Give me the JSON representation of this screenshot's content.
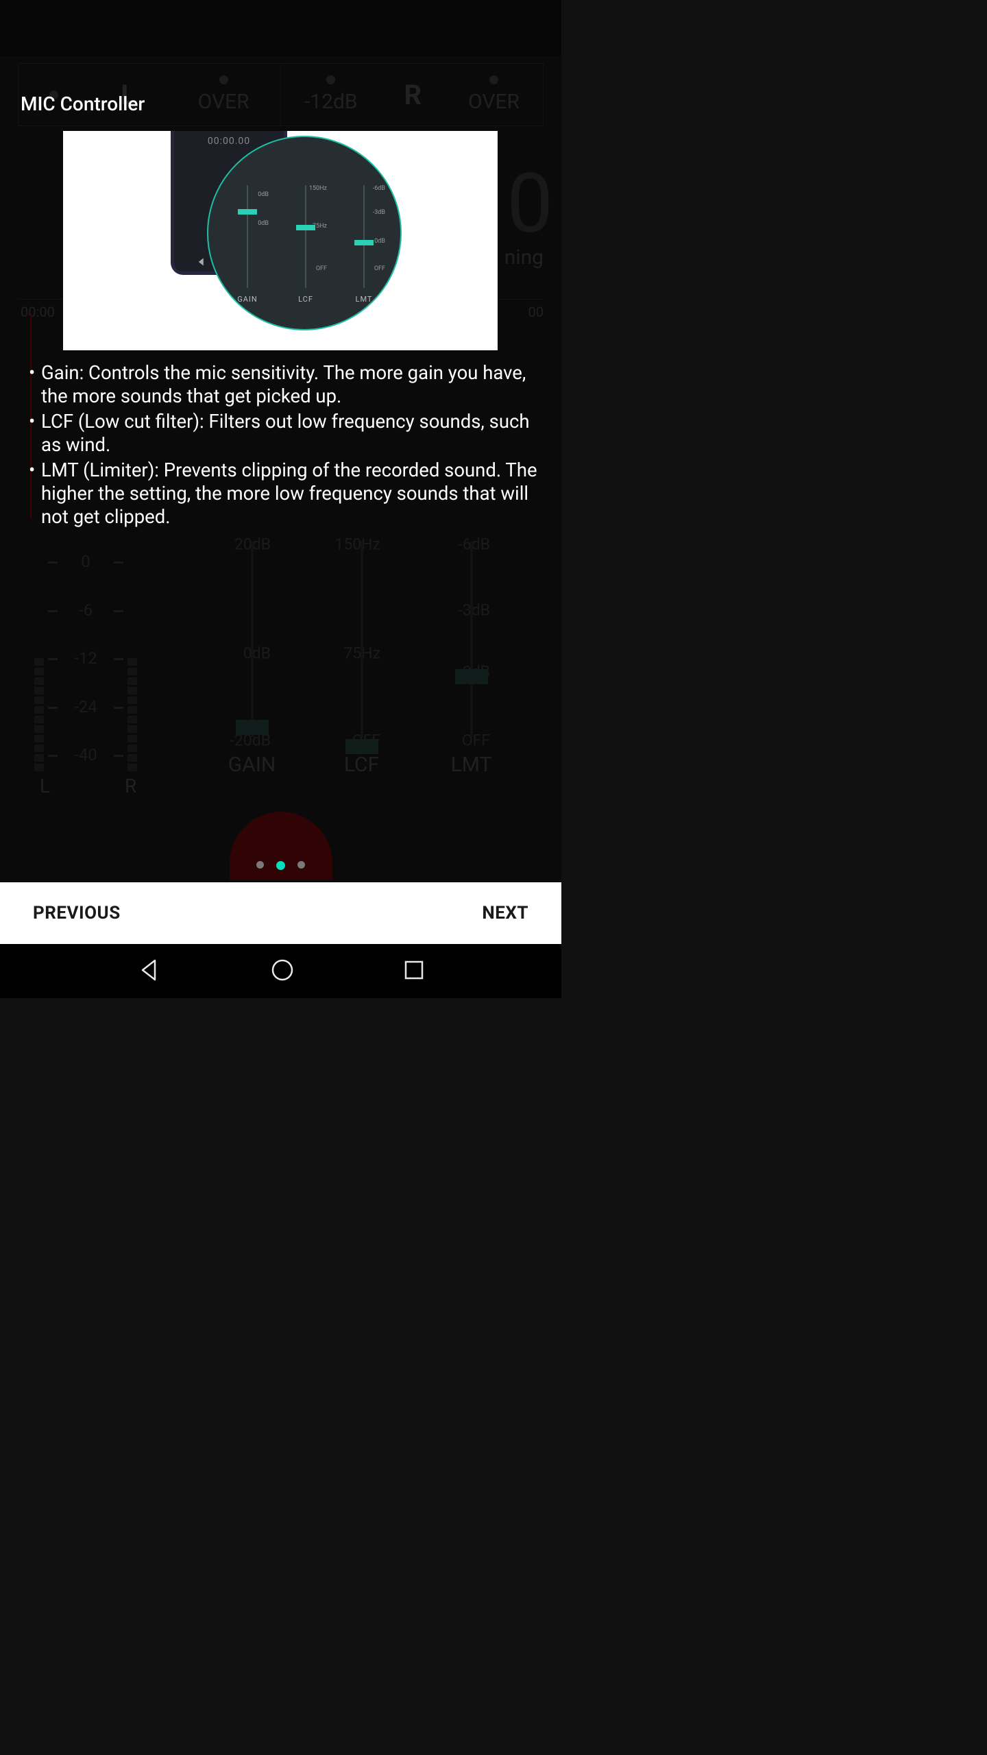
{
  "overlay": {
    "title": "MIC Controller",
    "bullets": [
      "Gain: Controls the mic sensitivity. The more gain you have, the more sounds that get picked up.",
      "LCF (Low cut filter): Filters out low frequency sounds, such as wind.",
      "LMT (Limiter): Prevents clipping of the recorded sound. The higher the setting, the more low frequency sounds that will not get clipped."
    ],
    "pager": {
      "count": 3,
      "active": 1
    },
    "prev_label": "PREVIOUS",
    "next_label": "NEXT"
  },
  "tutorial_image": {
    "phone_time": "00:00.00",
    "sliders": [
      {
        "name": "GAIN",
        "ticks": [
          "0dB",
          "0dB"
        ],
        "thumb_pct": 25
      },
      {
        "name": "LCF",
        "ticks": [
          "150Hz",
          "75Hz",
          "OFF"
        ],
        "thumb_pct": 46
      },
      {
        "name": "LMT",
        "ticks": [
          "-6dB",
          "-3dB",
          "0dB",
          "OFF"
        ],
        "thumb_pct": 60
      }
    ]
  },
  "background": {
    "top_meters": {
      "left": {
        "channel": "L",
        "label_over": "OVER"
      },
      "right": {
        "channel": "R",
        "label_over": "OVER",
        "label_mid": "-12dB"
      }
    },
    "big_clock_fragment": "0",
    "status_suffix": "ning",
    "timeline": {
      "start": "00:00",
      "end_fragment": "00"
    },
    "level_scale": [
      "0",
      "-6",
      "-12",
      "-24",
      "-40"
    ],
    "level_channels": {
      "left": "L",
      "right": "R"
    },
    "sliders": {
      "gain": {
        "name": "GAIN",
        "top": "20dB",
        "mid": "0dB",
        "bot": "-20dB"
      },
      "lcf": {
        "name": "LCF",
        "top": "150Hz",
        "mid": "75Hz",
        "bot": "OFF"
      },
      "lmt": {
        "name": "LMT",
        "top": "-6dB",
        "mid": "-3dB",
        "third": "0dB",
        "bot": "OFF"
      }
    }
  }
}
